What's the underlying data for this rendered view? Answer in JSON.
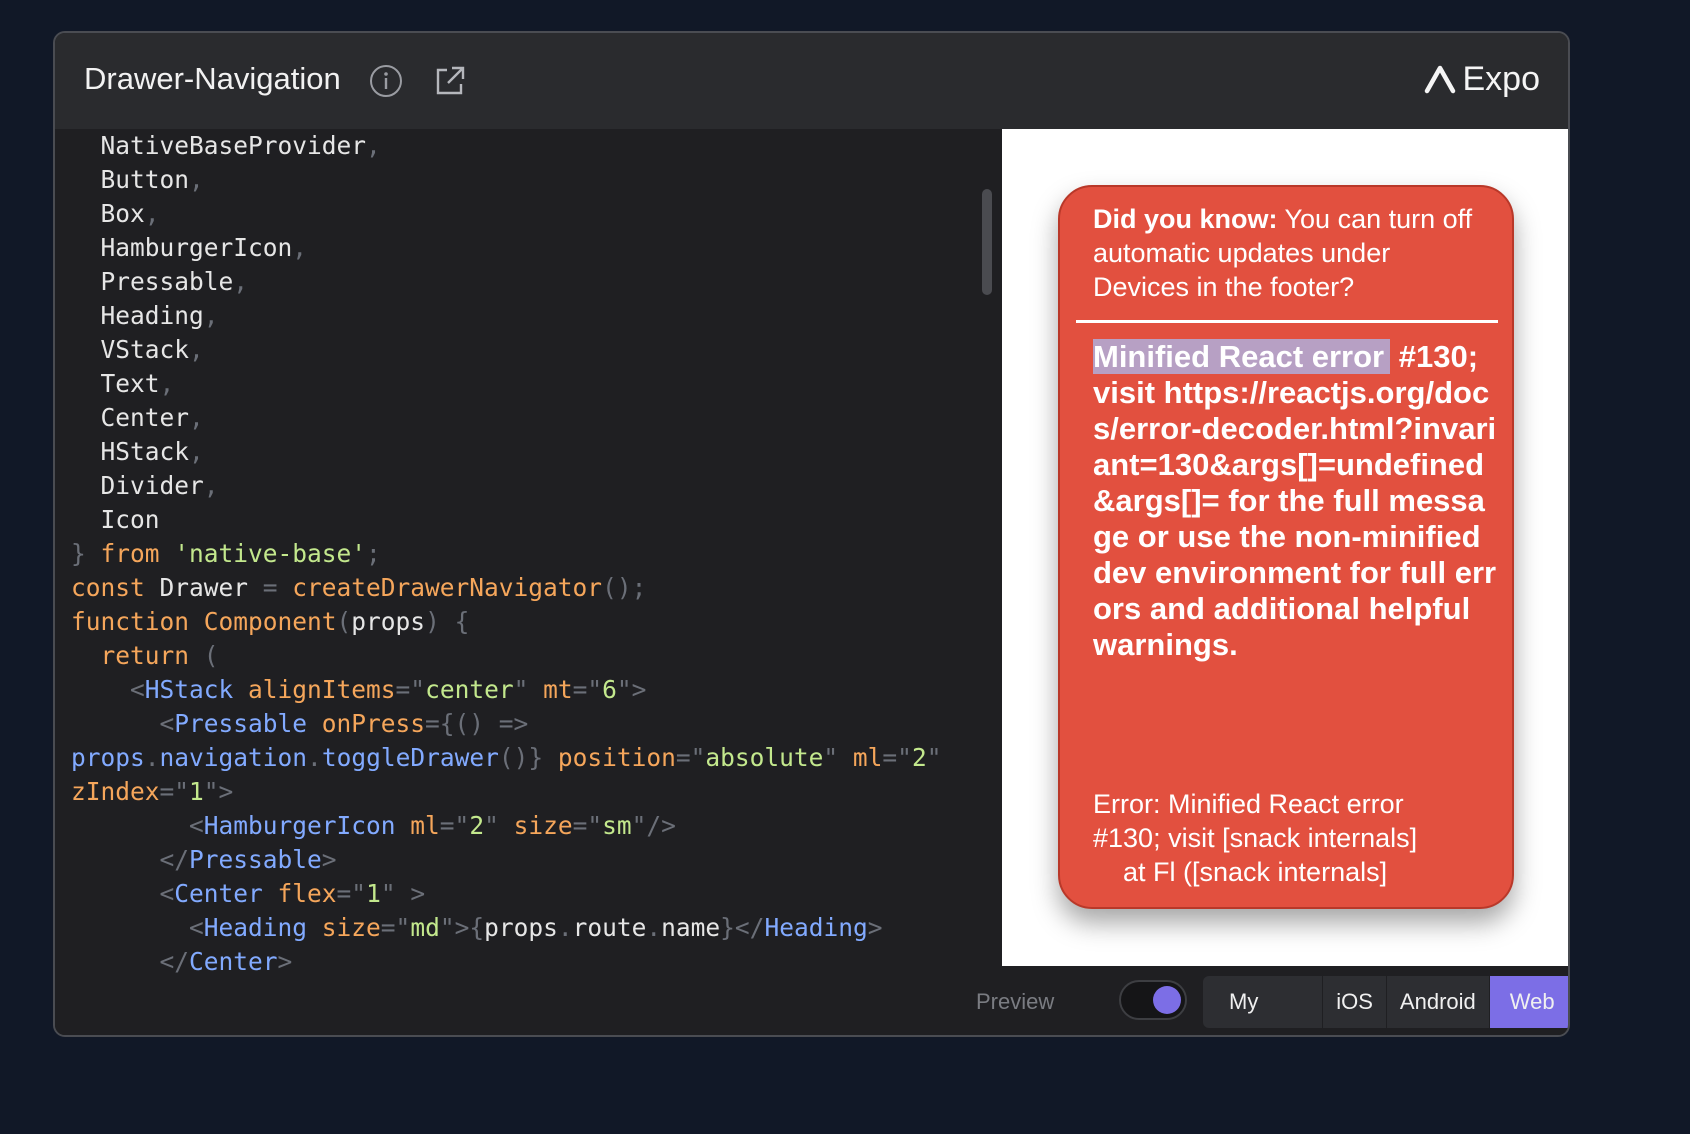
{
  "header": {
    "title": "Drawer-Navigation",
    "brand": "Expo"
  },
  "editor": {
    "lines": [
      [
        [
          "  NativeBaseProvider",
          ""
        ],
        [
          ",",
          "p"
        ]
      ],
      [
        [
          "  Button",
          ""
        ],
        [
          ",",
          "p"
        ]
      ],
      [
        [
          "  Box",
          ""
        ],
        [
          ",",
          "p"
        ]
      ],
      [
        [
          "  HamburgerIcon",
          ""
        ],
        [
          ",",
          "p"
        ]
      ],
      [
        [
          "  Pressable",
          ""
        ],
        [
          ",",
          "p"
        ]
      ],
      [
        [
          "  Heading",
          ""
        ],
        [
          ",",
          "p"
        ]
      ],
      [
        [
          "  VStack",
          ""
        ],
        [
          ",",
          "p"
        ]
      ],
      [
        [
          "  Text",
          ""
        ],
        [
          ",",
          "p"
        ]
      ],
      [
        [
          "  Center",
          ""
        ],
        [
          ",",
          "p"
        ]
      ],
      [
        [
          "  HStack",
          ""
        ],
        [
          ",",
          "p"
        ]
      ],
      [
        [
          "  Divider",
          ""
        ],
        [
          ",",
          "p"
        ]
      ],
      [
        [
          "  Icon",
          ""
        ]
      ],
      [
        [
          "}",
          "p"
        ],
        [
          " from ",
          "k"
        ],
        [
          "'native-base'",
          "s"
        ],
        [
          ";",
          "p"
        ]
      ],
      [
        [
          "const ",
          "k"
        ],
        [
          "Drawer ",
          ""
        ],
        [
          "= ",
          "p"
        ],
        [
          "createDrawerNavigator",
          "k"
        ],
        [
          "();",
          "p"
        ]
      ],
      [
        [
          "function ",
          "k"
        ],
        [
          "Component",
          "k"
        ],
        [
          "(",
          "p"
        ],
        [
          "props",
          ""
        ],
        [
          ") {",
          "p"
        ]
      ],
      [
        [
          "  return ",
          "k"
        ],
        [
          "(",
          "p"
        ]
      ],
      [
        [
          "    <",
          "p"
        ],
        [
          "HStack ",
          "t"
        ],
        [
          "alignItems",
          "a"
        ],
        [
          "=\"",
          "p"
        ],
        [
          "center",
          "s"
        ],
        [
          "\" ",
          "p"
        ],
        [
          "mt",
          "a"
        ],
        [
          "=\"",
          "p"
        ],
        [
          "6",
          "s"
        ],
        [
          "\">",
          "p"
        ]
      ],
      [
        [
          "      <",
          "p"
        ],
        [
          "Pressable ",
          "t"
        ],
        [
          "onPress",
          "a"
        ],
        [
          "={() =>",
          "p"
        ]
      ],
      [
        [
          "props",
          "t"
        ],
        [
          ".",
          "p"
        ],
        [
          "navigation",
          "t"
        ],
        [
          ".",
          "p"
        ],
        [
          "toggleDrawer",
          "t"
        ],
        [
          "()} ",
          "p"
        ],
        [
          "position",
          "a"
        ],
        [
          "=\"",
          "p"
        ],
        [
          "absolute",
          "s"
        ],
        [
          "\" ",
          "p"
        ],
        [
          "ml",
          "a"
        ],
        [
          "=\"",
          "p"
        ],
        [
          "2",
          "s"
        ],
        [
          "\"",
          "p"
        ]
      ],
      [
        [
          "zIndex",
          "a"
        ],
        [
          "=\"",
          "p"
        ],
        [
          "1",
          "s"
        ],
        [
          "\">",
          "p"
        ]
      ],
      [
        [
          "        <",
          "p"
        ],
        [
          "HamburgerIcon ",
          "t"
        ],
        [
          "ml",
          "a"
        ],
        [
          "=\"",
          "p"
        ],
        [
          "2",
          "s"
        ],
        [
          "\" ",
          "p"
        ],
        [
          "size",
          "a"
        ],
        [
          "=\"",
          "p"
        ],
        [
          "sm",
          "s"
        ],
        [
          "\"/>",
          "p"
        ]
      ],
      [
        [
          "      </",
          "p"
        ],
        [
          "Pressable",
          "t"
        ],
        [
          ">",
          "p"
        ]
      ],
      [
        [
          "      <",
          "p"
        ],
        [
          "Center ",
          "t"
        ],
        [
          "flex",
          "a"
        ],
        [
          "=\"",
          "p"
        ],
        [
          "1",
          "s"
        ],
        [
          "\" >",
          "p"
        ]
      ],
      [
        [
          "        <",
          "p"
        ],
        [
          "Heading ",
          "t"
        ],
        [
          "size",
          "a"
        ],
        [
          "=\"",
          "p"
        ],
        [
          "md",
          "s"
        ],
        [
          "\">{",
          "p"
        ],
        [
          "props",
          ""
        ],
        [
          ".",
          "p"
        ],
        [
          "route",
          ""
        ],
        [
          ".",
          "p"
        ],
        [
          "name",
          ""
        ],
        [
          "}</",
          "p"
        ],
        [
          "Heading",
          "t"
        ],
        [
          ">",
          "p"
        ]
      ],
      [
        [
          "      </",
          "p"
        ],
        [
          "Center",
          "t"
        ],
        [
          ">",
          "p"
        ]
      ]
    ]
  },
  "preview": {
    "tip_bold": "Did you know:",
    "tip_text": " You can turn off automatic updates under Devices in the footer?",
    "error_highlight": "Minified React error",
    "error_rest": " #130; visit https://reactjs.org/docs/error-decoder.html?invariant=130&args[]=undefined&args[]= for the full message or use the non-minified dev environment for full errors and additional helpful warnings.",
    "error_detail_1": "Error: Minified React error",
    "error_detail_2": "#130; visit [snack internals]",
    "error_detail_3": "    at Fl ([snack internals]"
  },
  "footer": {
    "preview_label": "Preview",
    "preview_toggle_on": true,
    "platforms": [
      "My Device",
      "iOS",
      "Android",
      "Web"
    ],
    "selected_platform": "Web"
  },
  "colors": {
    "accent": "#7c6ee6",
    "error_bg": "#e2503f",
    "page_bg": "#111827"
  }
}
